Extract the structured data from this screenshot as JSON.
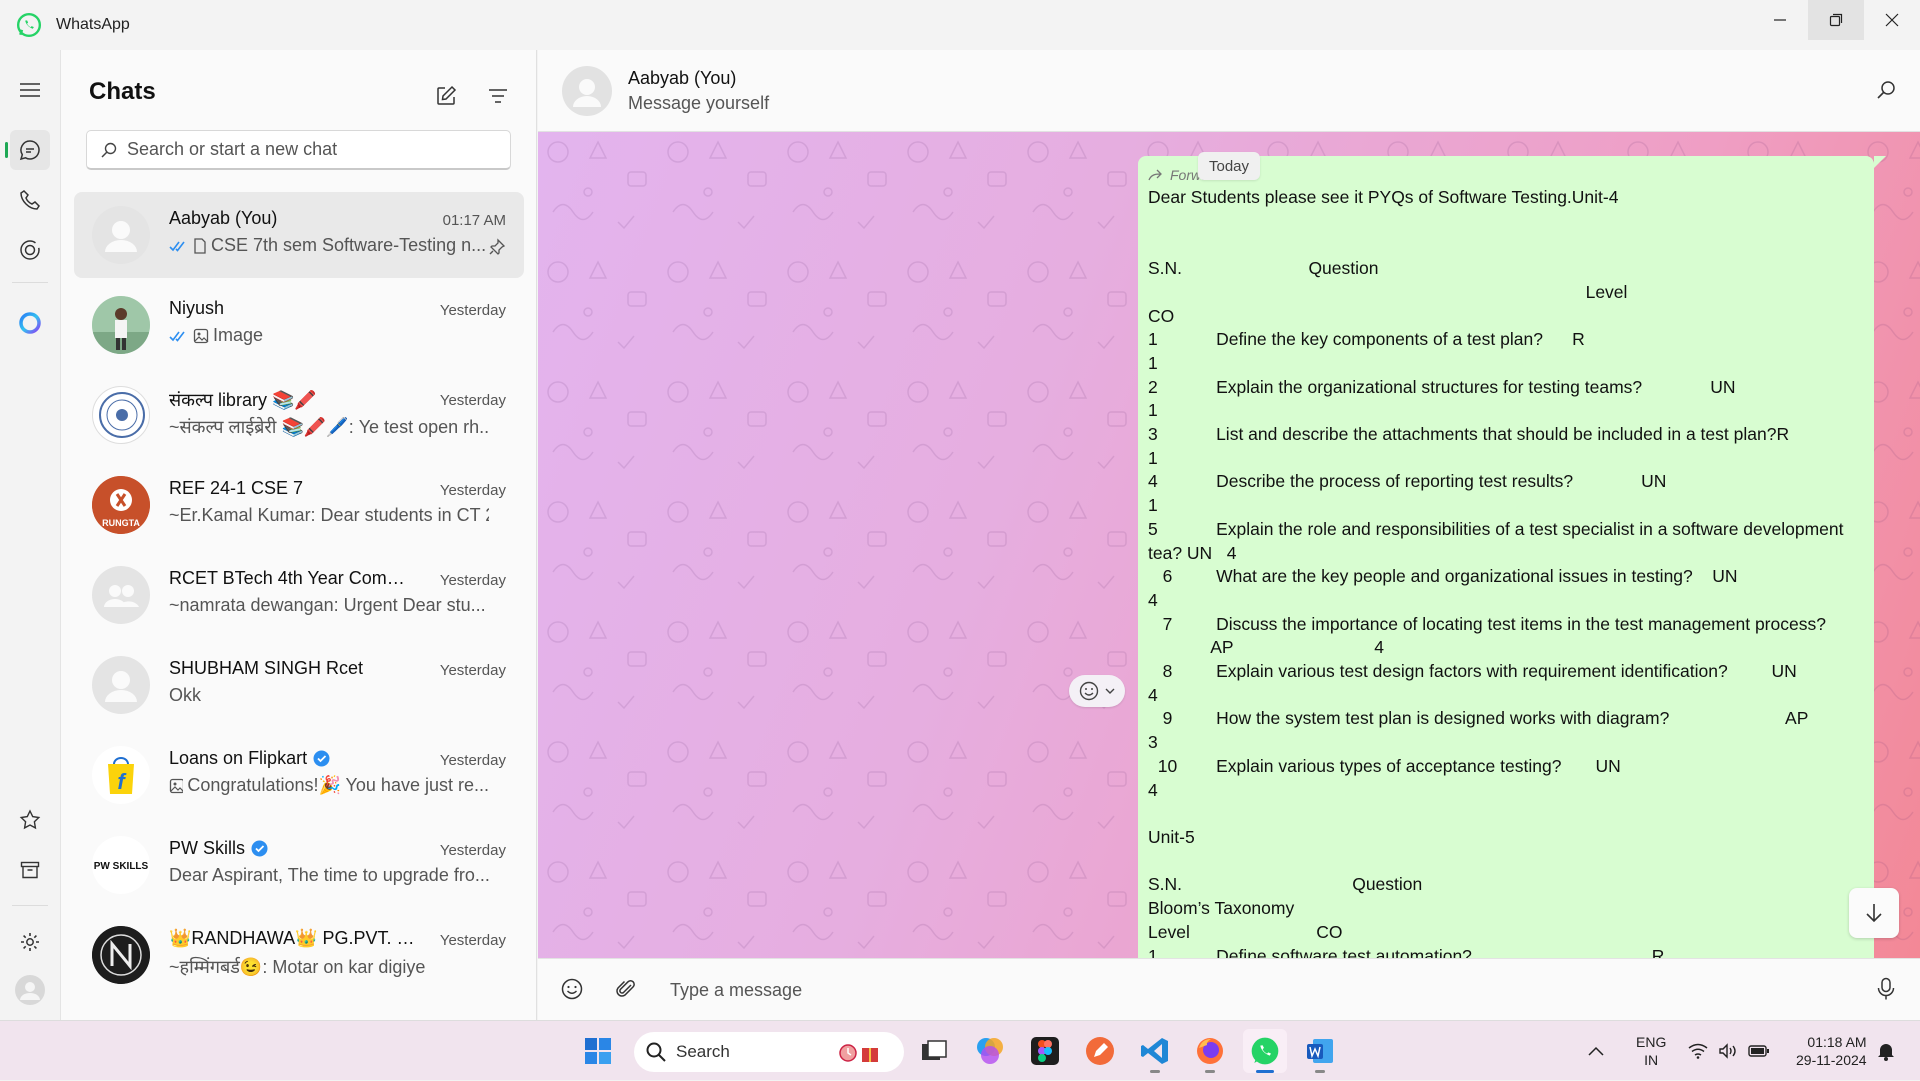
{
  "window": {
    "title": "WhatsApp"
  },
  "chats_panel": {
    "title": "Chats",
    "search_placeholder": "Search or start a new chat",
    "items": [
      {
        "name": "Aabyab (You)",
        "time": "01:17 AM",
        "preview": "CSE 7th sem Software-Testing n...",
        "pinned": true
      },
      {
        "name": "Niyush",
        "time": "Yesterday",
        "preview": "Image"
      },
      {
        "name": "संकल्प library 📚🖍️",
        "time": "Yesterday",
        "preview": "~संकल्प लाईब्रेरी 📚🖍️🖊️: Ye test open rh..."
      },
      {
        "name": "REF 24-1 CSE 7",
        "time": "Yesterday",
        "preview": "~Er.Kamal Kumar: Dear students in CT 2..."
      },
      {
        "name": "RCET BTech 4th Year Commu...",
        "time": "Yesterday",
        "preview": "~namrata dewangan: Urgent  Dear stu..."
      },
      {
        "name": "SHUBHAM SINGH Rcet",
        "time": "Yesterday",
        "preview": "Okk"
      },
      {
        "name": "Loans on Flipkart",
        "time": "Yesterday",
        "preview": "Congratulations!🎉  You have just re..."
      },
      {
        "name": "PW Skills",
        "time": "Yesterday",
        "preview": "Dear Aspirant,  The time to upgrade fro..."
      },
      {
        "name": "👑RANDHAWA👑 PG.PVT. LTD",
        "time": "Yesterday",
        "preview": "~हम्मिंगबर्ड😉: Motar on kar digiye"
      }
    ],
    "avatar_texts": {
      "rungta": "RUNGTA",
      "pw": "PW SKILLS",
      "flipkart": "f"
    }
  },
  "conversation": {
    "name": "Aabyab (You)",
    "subtitle": "Message yourself",
    "date_label": "Today",
    "forwarded_label": "Forwarded",
    "message_lines": [
      "Dear Students please see it PYQs of Software Testing.Unit-4",
      "",
      "",
      "S.N.                          Question",
      "                                                                                          Level",
      "CO",
      "1            Define the key components of a test plan?      R",
      "1",
      "2            Explain the organizational structures for testing teams?              UN",
      "1",
      "3            List and describe the attachments that should be included in a test plan?R",
      "1",
      "4            Describe the process of reporting test results?              UN",
      "1",
      "5            Explain the role and responsibilities of a test specialist in a software development",
      "tea? UN   4",
      "   6         What are the key people and organizational issues in testing?    UN",
      "4",
      "   7         Discuss the importance of locating test items in the test management process?",
      "             AP                             4",
      "   8         Explain various test design factors with requirement identification?         UN",
      "4",
      "   9         How the system test plan is designed works with diagram?                        AP",
      "3",
      "  10        Explain various types of acceptance testing?       UN",
      "4",
      "",
      "Unit-5",
      "",
      "S.N.                                   Question",
      "Bloom’s Taxonomy",
      "Level                          CO",
      "1            Define software test automation?                                     R"
    ],
    "composer_placeholder": "Type a message"
  },
  "taskbar": {
    "search_label": "Search",
    "language": "ENG",
    "region": "IN",
    "time": "01:18 AM",
    "date": "29-11-2024"
  },
  "colors": {
    "accent": "#1fa855",
    "bubble": "#d8fdd1",
    "wa_green": "#25d366"
  }
}
